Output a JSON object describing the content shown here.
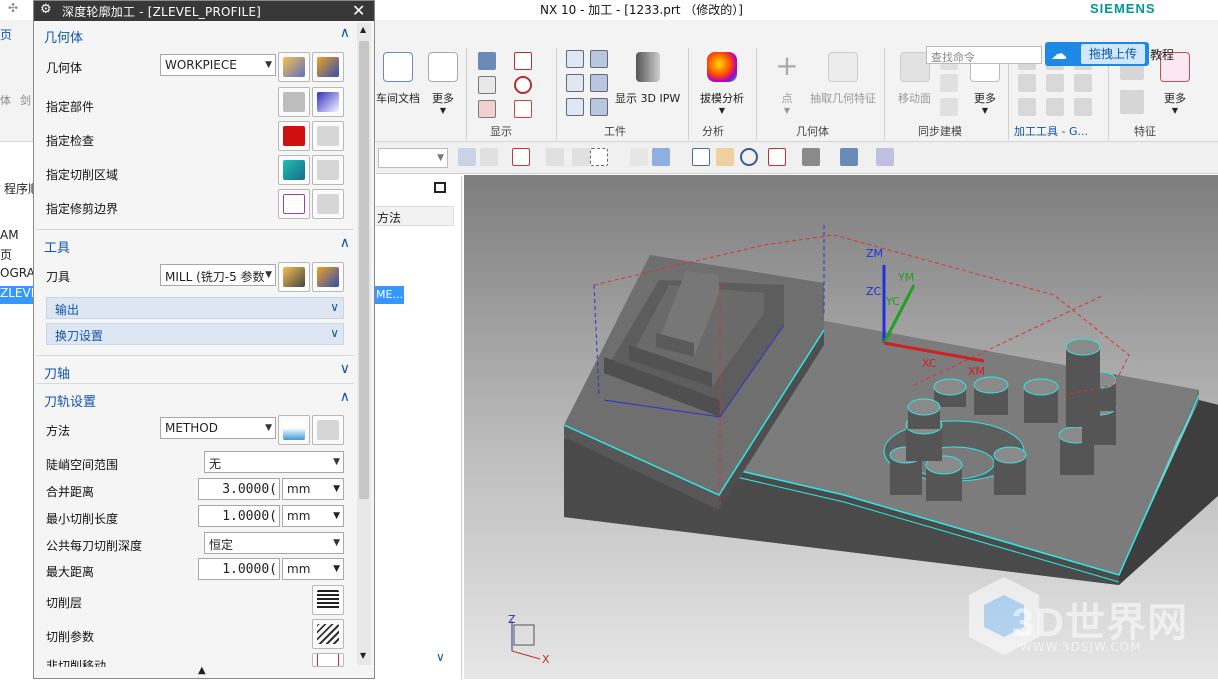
{
  "app": {
    "title": "NX 10 - 加工 - [1233.prt （修改的）]",
    "brand": "SIEMENS"
  },
  "search": {
    "placeholder": "查找命令"
  },
  "upload": {
    "label": "拖拽上传"
  },
  "tutorial": "教程",
  "ribbon": {
    "left_buttons": [
      {
        "label": "体"
      },
      {
        "label": "剑"
      }
    ],
    "buttons": [
      {
        "id": "workpiece-doc",
        "label": "车间文档"
      },
      {
        "id": "more1",
        "label": "更多"
      },
      {
        "id": "show3d",
        "label": "显示 3D IPW"
      },
      {
        "id": "draft",
        "label": "拔模分析"
      },
      {
        "id": "point",
        "label": "点"
      },
      {
        "id": "extract",
        "label": "抽取几何特征"
      },
      {
        "id": "moveface",
        "label": "移动面"
      },
      {
        "id": "more2",
        "label": "更多"
      },
      {
        "id": "more3",
        "label": "更多"
      }
    ],
    "groups": [
      {
        "label": "显示"
      },
      {
        "label": "工件"
      },
      {
        "label": "分析"
      },
      {
        "label": "几何体"
      },
      {
        "label": "同步建模"
      },
      {
        "label": "加工工具 - G..."
      },
      {
        "label": "特征"
      }
    ]
  },
  "tab_partial": "页",
  "navigator": {
    "title": "程序顺",
    "method_col": "方法",
    "rows": [
      "AM",
      "页",
      "OGRA",
      "ZLEVEL_"
    ],
    "method_cell": "ME..."
  },
  "dialog": {
    "title": "深度轮廓加工 - [ZLEVEL_PROFILE]",
    "geometry": {
      "section": "几何体",
      "geometry_label": "几何体",
      "geometry_value": "WORKPIECE",
      "specify_part": "指定部件",
      "specify_check": "指定检查",
      "specify_cut_area": "指定切削区域",
      "specify_trim": "指定修剪边界"
    },
    "tool": {
      "section": "工具",
      "tool_label": "刀具",
      "tool_value": "MILL (铣刀-5 参数",
      "output": "输出",
      "tool_change": "换刀设置"
    },
    "axis": {
      "section": "刀轴"
    },
    "path": {
      "section": "刀轨设置",
      "method_label": "方法",
      "method_value": "METHOD",
      "steep_label": "陡峭空间范围",
      "steep_value": "无",
      "merge_label": "合并距离",
      "merge_value": "3.0000(",
      "merge_unit": "mm",
      "min_cut_label": "最小切削长度",
      "min_cut_value": "1.0000(",
      "min_cut_unit": "mm",
      "depth_label": "公共每刀切削深度",
      "depth_value": "恒定",
      "max_dist_label": "最大距离",
      "max_dist_value": "1.0000(",
      "max_dist_unit": "mm",
      "cut_levels": "切削层",
      "cut_params": "切削参数",
      "non_cut": "非切削移动"
    }
  },
  "viewport": {
    "labels": {
      "zm": "ZM",
      "ym": "YM",
      "zc": "ZC",
      "yc": "YC",
      "xc": "XC",
      "xm": "XM",
      "triad_z": "Z",
      "triad_x": "X"
    }
  },
  "watermark": {
    "text": "3D世界网",
    "url": "WWW.3DSJW.COM"
  },
  "colors": {
    "accent": "#1e88e5",
    "dialog_header": "#383838",
    "selection": "#3399ff",
    "brand": "#009999"
  }
}
